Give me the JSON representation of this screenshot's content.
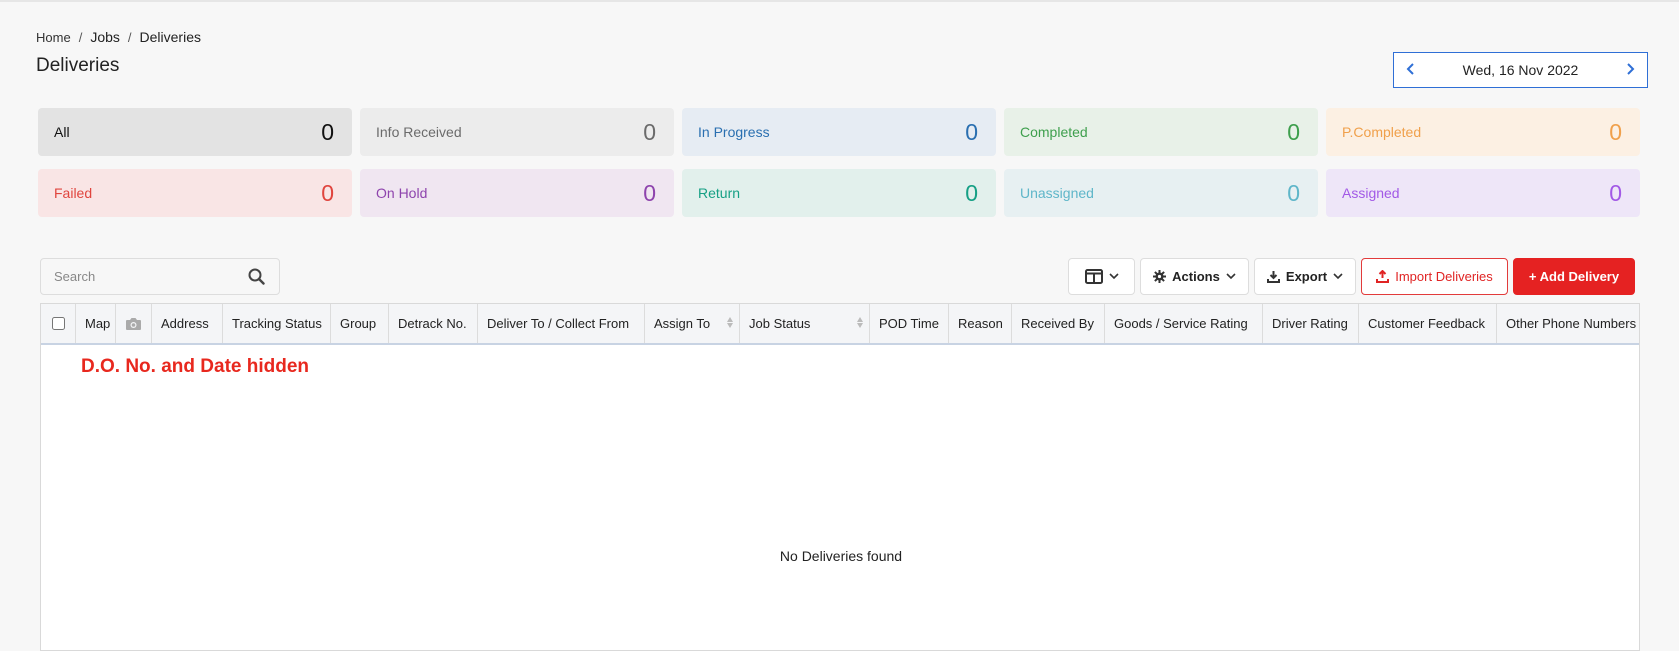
{
  "breadcrumb": {
    "home": "Home",
    "jobs": "Jobs",
    "current": "Deliveries",
    "separator": "/"
  },
  "page_title": "Deliveries",
  "date_nav": {
    "date": "Wed, 16 Nov 2022"
  },
  "status_cards": [
    {
      "label": "All",
      "count": "0",
      "color": "#111111",
      "bg": "#e3e3e3"
    },
    {
      "label": "Info Received",
      "count": "0",
      "color": "#6b6b6b",
      "bg": "#ececec"
    },
    {
      "label": "In Progress",
      "count": "0",
      "color": "#2a6fb0",
      "bg": "#e6ecf3"
    },
    {
      "label": "Completed",
      "count": "0",
      "color": "#3e9f4d",
      "bg": "#e8f1e8"
    },
    {
      "label": "P.Completed",
      "count": "0",
      "color": "#f0a04b",
      "bg": "#fcf0e3"
    },
    {
      "label": "Failed",
      "count": "0",
      "color": "#e0453e",
      "bg": "#f9e5e5"
    },
    {
      "label": "On Hold",
      "count": "0",
      "color": "#8e44ad",
      "bg": "#f0e6f1"
    },
    {
      "label": "Return",
      "count": "0",
      "color": "#16a085",
      "bg": "#e2f0ec"
    },
    {
      "label": "Unassigned",
      "count": "0",
      "color": "#5fb6c9",
      "bg": "#e7f0f2"
    },
    {
      "label": "Assigned",
      "count": "0",
      "color": "#a259e6",
      "bg": "#eee6f8"
    }
  ],
  "toolbar": {
    "search_placeholder": "Search",
    "actions_label": "Actions",
    "export_label": "Export",
    "import_label": "Import Deliveries",
    "add_label": "+ Add Delivery"
  },
  "table": {
    "columns": [
      "Map",
      "Address",
      "Tracking Status",
      "Group",
      "Detrack No.",
      "Deliver To / Collect From",
      "Assign To",
      "Job Status",
      "POD Time",
      "Reason",
      "Received By",
      "Goods / Service Rating",
      "Driver Rating",
      "Customer Feedback",
      "Other Phone Numbers"
    ],
    "annotation": "D.O. No.  and Date hidden",
    "empty_message": "No Deliveries found"
  }
}
